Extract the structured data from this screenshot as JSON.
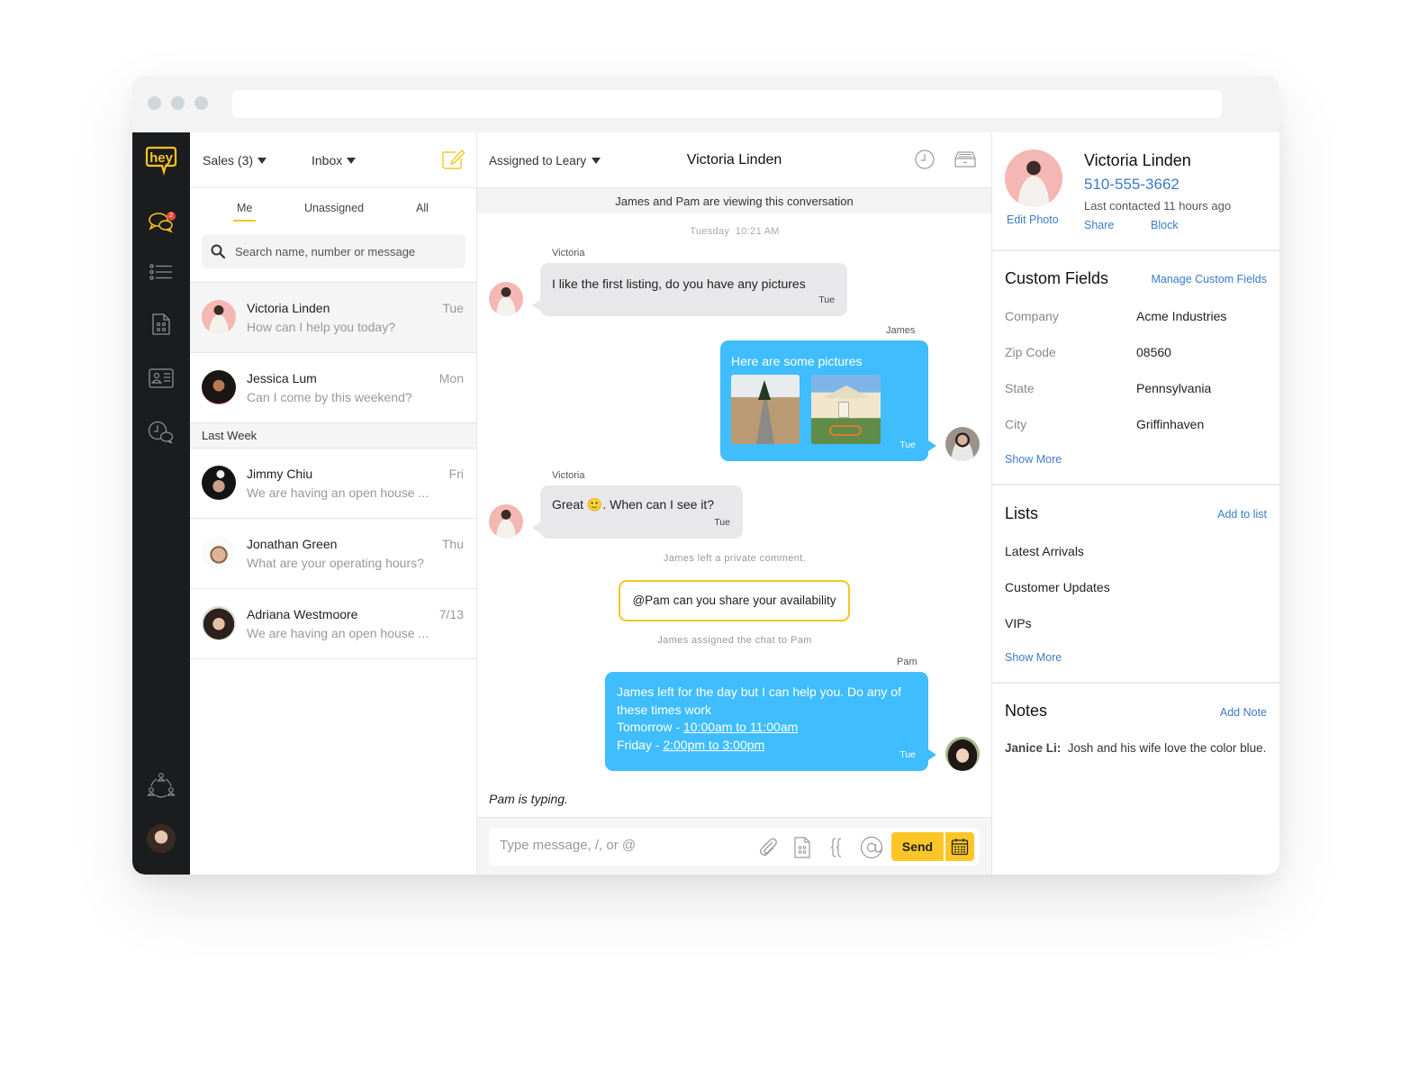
{
  "window": {
    "url": ""
  },
  "nav": {
    "logo": "hey",
    "items": [
      {
        "name": "conversations",
        "icon": "chat-bubbles-icon",
        "badge": "2"
      },
      {
        "name": "lists",
        "icon": "list-icon"
      },
      {
        "name": "templates",
        "icon": "template-doc-icon"
      },
      {
        "name": "contacts",
        "icon": "contact-card-icon"
      },
      {
        "name": "history",
        "icon": "clock-chat-icon"
      },
      {
        "name": "team",
        "icon": "team-icon"
      }
    ]
  },
  "list": {
    "team_dropdown": "Sales (3)",
    "inbox_dropdown": "Inbox",
    "tabs": [
      {
        "label": "Me",
        "active": true
      },
      {
        "label": "Unassigned"
      },
      {
        "label": "All"
      }
    ],
    "search_placeholder": "Search name, number or message",
    "recent": [
      {
        "name": "Victoria Linden",
        "time": "Tue",
        "preview": "How can I help you today?",
        "selected": true
      },
      {
        "name": "Jessica Lum",
        "time": "Mon",
        "preview": "Can I come by this weekend?"
      }
    ],
    "section_label": "Last Week",
    "older": [
      {
        "name": "Jimmy Chiu",
        "time": "Fri",
        "preview": "We are having an open house ..."
      },
      {
        "name": "Jonathan Green",
        "time": "Thu",
        "preview": "What are your operating hours?"
      },
      {
        "name": "Adriana Westmoore",
        "time": "7/13",
        "preview": "We are having an open house ..."
      }
    ]
  },
  "chat": {
    "assigned": "Assigned to Leary",
    "title": "Victoria Linden",
    "viewing_banner": "James and Pam are viewing this conversation",
    "timestamp_day": "Tuesday",
    "timestamp_time": "10:21 AM",
    "messages": [
      {
        "sender": "Victoria",
        "text": "I like the first listing, do you have any pictures",
        "time": "Tue",
        "direction": "in"
      },
      {
        "sender": "James",
        "text": "Here are some pictures",
        "time": "Tue",
        "direction": "out",
        "attachments": [
          "boardwalk-field-photo",
          "cottage-bikes-photo"
        ]
      },
      {
        "sender": "Victoria",
        "text_before": "Great ",
        "emoji": "🙂",
        "text_after": ". When can I see it?",
        "time": "Tue",
        "direction": "in"
      },
      {
        "sender": "Pam",
        "line1": "James left for the day but I can help you. Do any of",
        "line2": "these times work",
        "slot1_label": "Tomorrow - ",
        "slot1": "10:00am to 11:00am",
        "slot2_label": "Friday - ",
        "slot2": "2:00pm to 3:00pm",
        "time": "Tue",
        "direction": "out"
      }
    ],
    "system_private": "James left a private comment.",
    "private_comment": "@Pam can you share your availability",
    "system_assigned": "James assigned the chat to Pam",
    "typing": "Pam is typing.",
    "composer_placeholder": "Type message, /, or @",
    "send_label": "Send"
  },
  "contact": {
    "name": "Victoria Linden",
    "phone": "510-555-3662",
    "last_contacted": "Last contacted 11 hours ago",
    "edit_photo": "Edit Photo",
    "share": "Share",
    "block": "Block",
    "custom_fields_title": "Custom Fields",
    "manage_link": "Manage Custom Fields",
    "fields": [
      {
        "label": "Company",
        "value": "Acme Industries"
      },
      {
        "label": "Zip Code",
        "value": "08560"
      },
      {
        "label": "State",
        "value": "Pennsylvania"
      },
      {
        "label": "City",
        "value": "Griffinhaven"
      }
    ],
    "show_more": "Show More",
    "lists_title": "Lists",
    "add_to_list": "Add to list",
    "lists": [
      "Latest Arrivals",
      "Customer Updates",
      "VIPs"
    ],
    "lists_show_more": "Show More",
    "notes_title": "Notes",
    "add_note": "Add Note",
    "note_author": "Janice Li:",
    "note_text": "Josh and his wife love the color blue."
  },
  "colors": {
    "accent": "#f7c51e",
    "outgoing": "#3fbdfc",
    "link": "#3c7cc6",
    "rail": "#1b1c1e",
    "badge": "#e5493a"
  }
}
